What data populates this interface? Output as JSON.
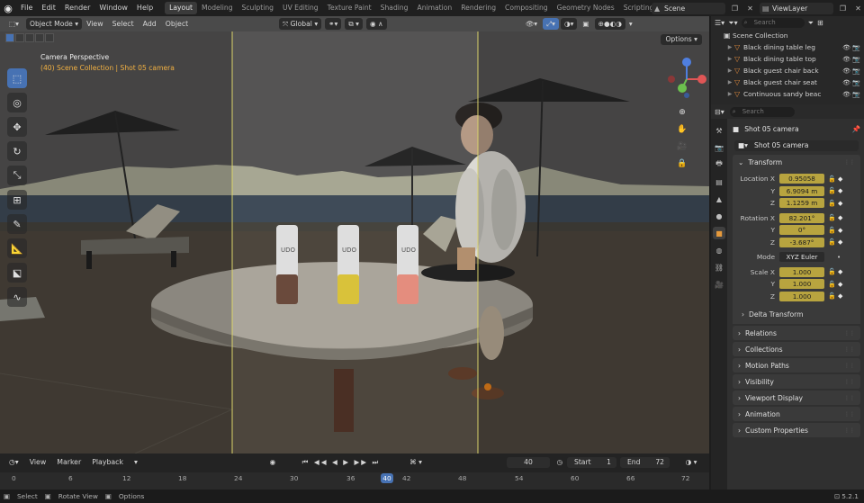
{
  "topbar": {
    "menus": [
      "File",
      "Edit",
      "Render",
      "Window",
      "Help"
    ],
    "workspaces": [
      "Layout",
      "Modeling",
      "Sculpting",
      "UV Editing",
      "Texture Paint",
      "Shading",
      "Animation",
      "Rendering",
      "Compositing",
      "Geometry Nodes",
      "Scripting"
    ],
    "active_workspace": "Layout",
    "scene": "Scene",
    "view_layer": "ViewLayer"
  },
  "viewport": {
    "mode": "Object Mode",
    "menus": [
      "View",
      "Select",
      "Add",
      "Object"
    ],
    "transform_orientation": "Global",
    "options_label": "Options",
    "camera_title": "Camera Perspective",
    "camera_context": "(40) Scene Collection | Shot 05 camera",
    "can_label": "UDO"
  },
  "outliner": {
    "search_placeholder": "Search",
    "root": "Scene Collection",
    "items": [
      "Black dining table leg",
      "Black dining table top",
      "Black guest chair back",
      "Black guest chair seat",
      "Continuous sandy beac"
    ]
  },
  "properties": {
    "search_placeholder": "Search",
    "object_title": "Shot 05 camera",
    "object_name": "Shot 05 camera",
    "transform": {
      "header": "Transform",
      "location_label": "Location X",
      "location": [
        "0.95058",
        "6.9094 m",
        "1.1259 m"
      ],
      "rotation_label": "Rotation X",
      "rotation": [
        "82.201°",
        "0°",
        "-3.687°"
      ],
      "mode_label": "Mode",
      "mode": "XYZ Euler",
      "scale_label": "Scale X",
      "scale": [
        "1.000",
        "1.000",
        "1.000"
      ],
      "y": "Y",
      "z": "Z",
      "delta": "Delta Transform"
    },
    "panels": [
      "Relations",
      "Collections",
      "Motion Paths",
      "Visibility",
      "Viewport Display",
      "Animation",
      "Custom Properties"
    ]
  },
  "timeline": {
    "menus": [
      "View",
      "Marker",
      "Playback"
    ],
    "current_frame": "40",
    "start_label": "Start",
    "start": "1",
    "end_label": "End",
    "end": "72",
    "ticks": [
      "0",
      "6",
      "12",
      "18",
      "24",
      "30",
      "36",
      "42",
      "48",
      "54",
      "60",
      "66",
      "72"
    ],
    "playhead": "40"
  },
  "statusbar": {
    "items": [
      "Select",
      "Rotate View",
      "Options"
    ],
    "version": "5.2.1"
  }
}
